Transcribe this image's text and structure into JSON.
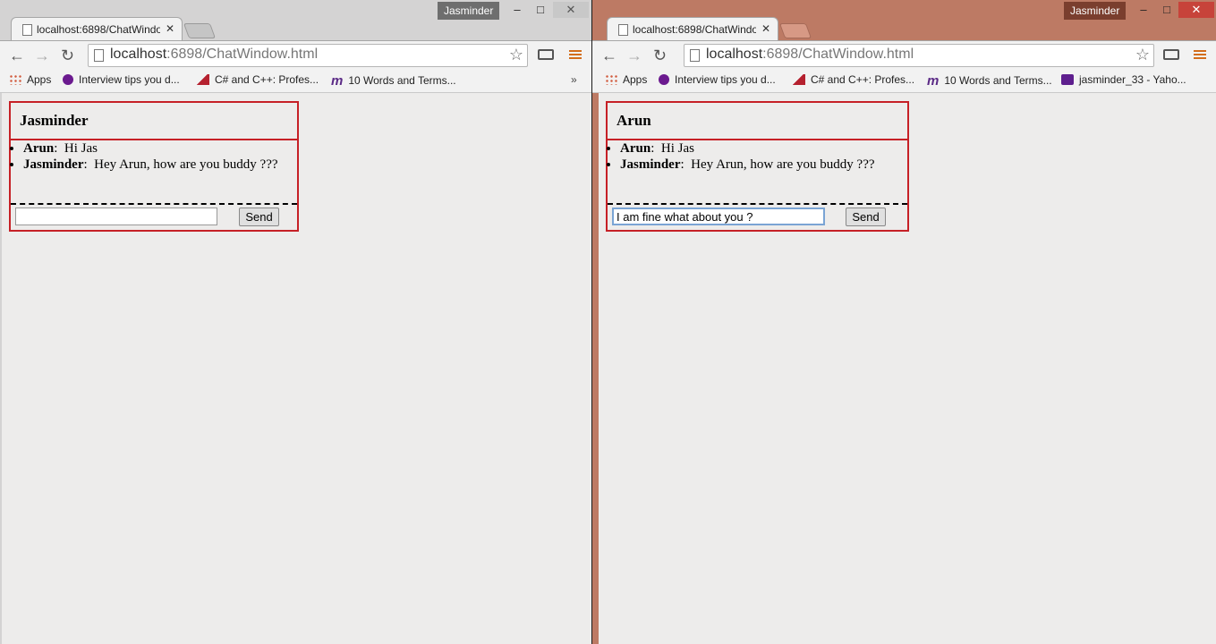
{
  "windows": [
    {
      "profile_name": "Jasminder",
      "tab_title": "localhost:6898/ChatWindow.html",
      "url_host": "localhost",
      "url_rest": ":6898/ChatWindow.html",
      "bookmarks": [
        {
          "icon": "apps-icon",
          "label": "Apps"
        },
        {
          "icon": "yahoo-icon",
          "label": "Interview tips you d..."
        },
        {
          "icon": "codeproject-icon",
          "label": "C# and C++: Profes..."
        },
        {
          "icon": "m-icon",
          "label": "10 Words and Terms..."
        }
      ],
      "bookmarks_more": "»",
      "chat": {
        "header_name": "Jasminder",
        "messages": [
          {
            "from": "Arun",
            "text": "Hi Jas"
          },
          {
            "from": "Jasminder",
            "text": "Hey Arun, how are you buddy ???"
          }
        ],
        "input_value": "",
        "send_label": "Send"
      }
    },
    {
      "profile_name": "Jasminder",
      "tab_title": "localhost:6898/ChatWindow.html",
      "url_host": "localhost",
      "url_rest": ":6898/ChatWindow.html",
      "bookmarks": [
        {
          "icon": "apps-icon",
          "label": "Apps"
        },
        {
          "icon": "yahoo-icon",
          "label": "Interview tips you d..."
        },
        {
          "icon": "codeproject-icon",
          "label": "C# and C++: Profes..."
        },
        {
          "icon": "m-icon",
          "label": "10 Words and Terms..."
        },
        {
          "icon": "yahoo-mail-icon",
          "label": "jasminder_33 - Yaho..."
        }
      ],
      "bookmarks_more": "»",
      "chat": {
        "header_name": "Arun",
        "messages": [
          {
            "from": "Arun",
            "text": "Hi Jas"
          },
          {
            "from": "Jasminder",
            "text": "Hey Arun, how are you buddy ???"
          }
        ],
        "input_value": "I am fine what about you ?",
        "send_label": "Send"
      }
    }
  ],
  "glyphs": {
    "minimize": "‒",
    "maximize": "□",
    "close": "✕",
    "tab_close": "✕",
    "back": "←",
    "forward": "→",
    "reload": "↻",
    "star": "☆",
    "colon": ":"
  },
  "colors": {
    "chat_border": "#c62026",
    "accent_menu": "#d36d1b",
    "right_frame": "#bd7a64"
  }
}
